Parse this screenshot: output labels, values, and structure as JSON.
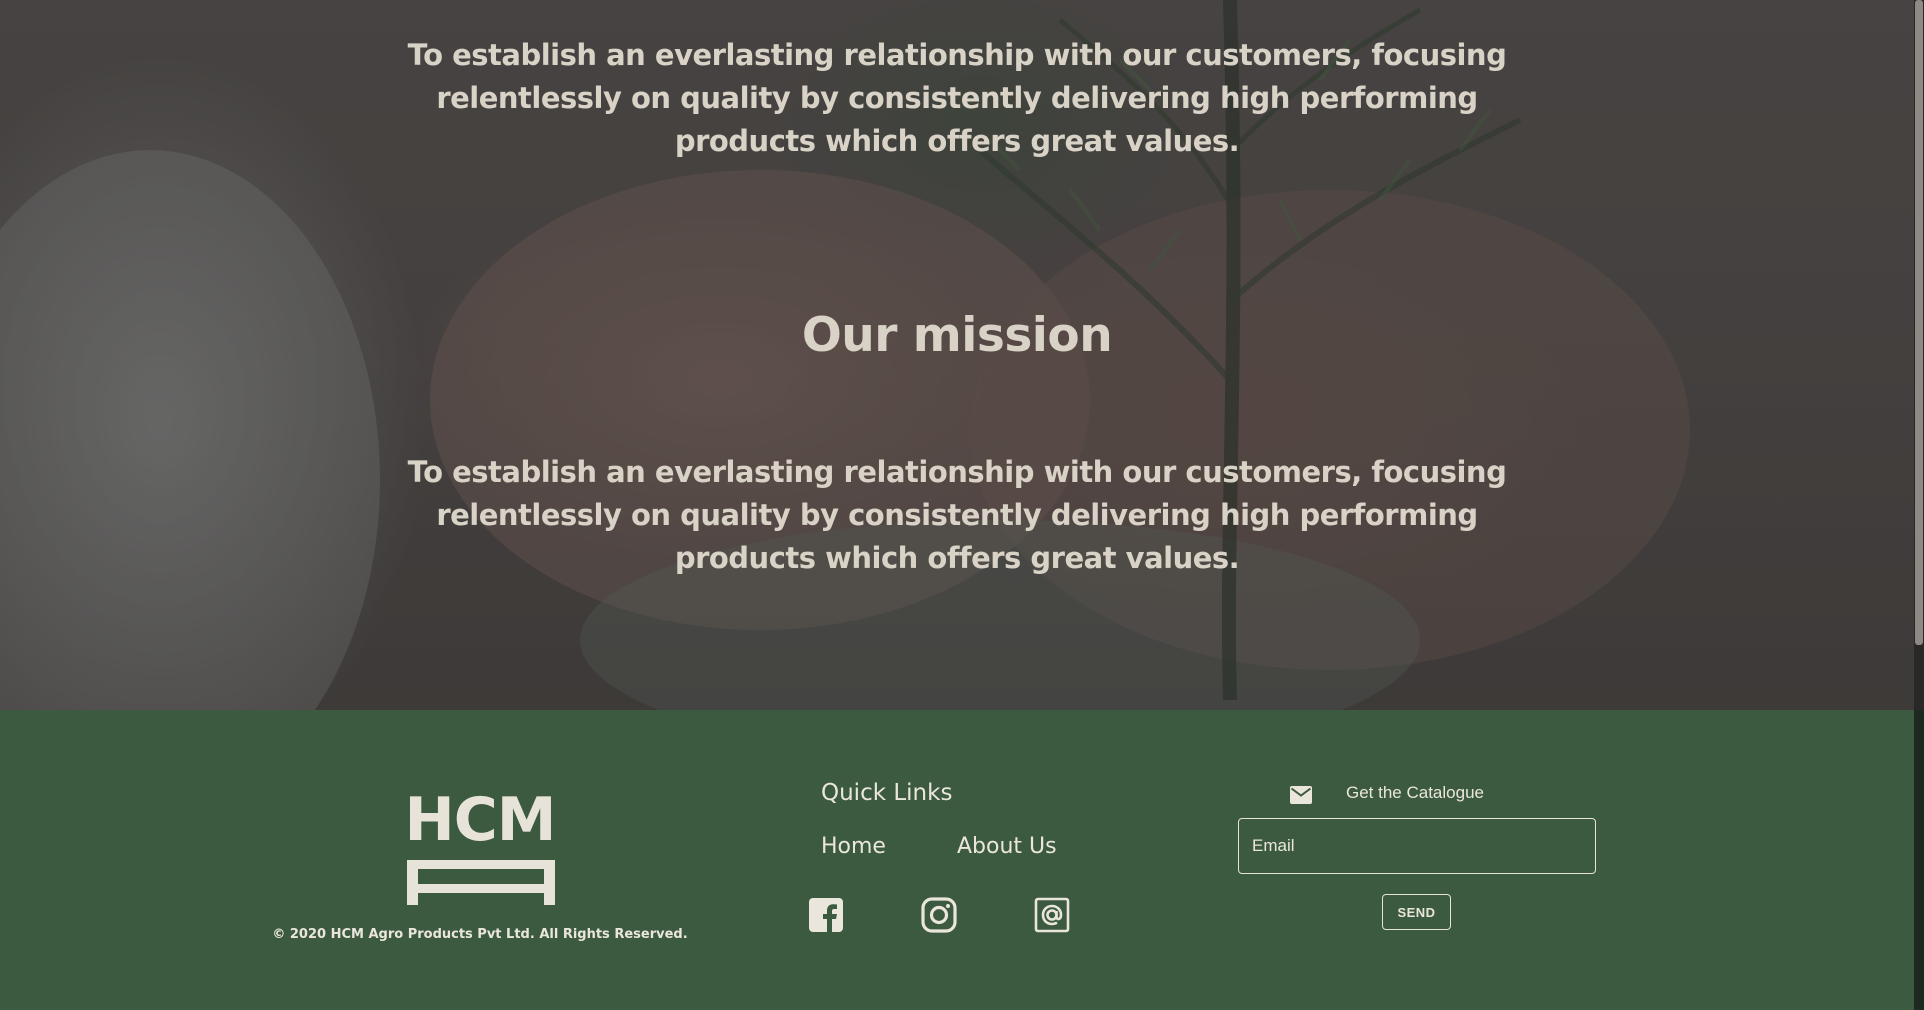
{
  "hero": {
    "intro_text": "To establish an everlasting relationship with our customers, focusing relentlessly on quality by consistently delivering high performing products which offers great values.",
    "mission_title": "Our mission",
    "mission_text": "To establish an everlasting relationship with our customers, focusing relentlessly on quality by consistently delivering high performing products which offers great values."
  },
  "footer": {
    "logo_text": "HCM",
    "copyright": "© 2020 HCM Agro Products Pvt Ltd. All Rights Reserved.",
    "quick_links_title": "Quick Links",
    "links": [
      {
        "label": "Home"
      },
      {
        "label": "About Us"
      }
    ],
    "social": [
      {
        "icon": "facebook-icon"
      },
      {
        "icon": "instagram-icon"
      },
      {
        "icon": "at-sign-icon"
      }
    ],
    "catalogue": {
      "icon": "envelope-icon",
      "label": "Get the Catalogue",
      "email_placeholder": "Email",
      "send_label": "SEND"
    }
  },
  "colors": {
    "footer_background": "#3b5a40",
    "footer_text": "#ebe6dc",
    "hero_text": "#d9d2c7"
  }
}
